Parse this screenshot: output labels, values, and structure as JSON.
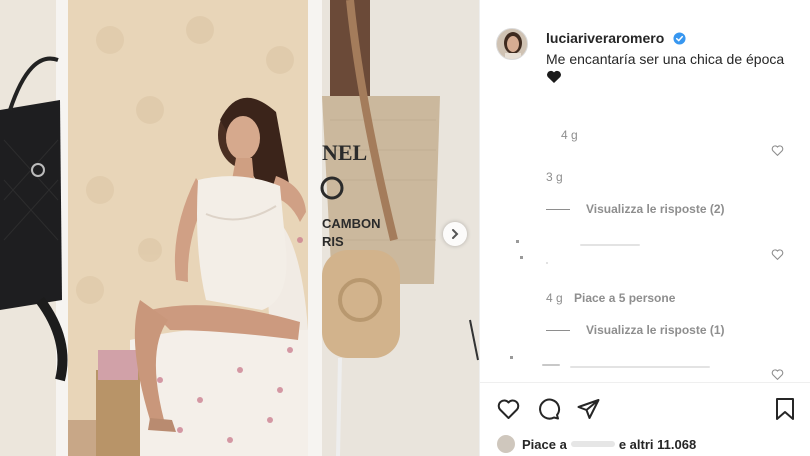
{
  "post": {
    "username": "luciariveraromero",
    "caption": "Me encantaría ser una chica de época",
    "caption_emoji": "black heart",
    "caption_time": "4 g"
  },
  "comments": [
    {
      "time": "3 g",
      "replies_label": "Visualizza le risposte (2)"
    },
    {
      "time": "4 g",
      "likes_label": "Piace a 5 persone",
      "replies_label": "Visualizza le risposte (1)"
    }
  ],
  "footer": {
    "likes_prefix": "Piace a",
    "likes_suffix": "e altri 11.068"
  },
  "icons": {
    "next": "chevron-right-icon",
    "like": "heart-icon",
    "comment": "comment-icon",
    "share": "send-icon",
    "save": "bookmark-icon",
    "verified": "verified-badge-icon"
  },
  "colors": {
    "verified_blue": "#3897f0",
    "secondary_text": "#8e8e8e",
    "primary_text": "#262626"
  }
}
